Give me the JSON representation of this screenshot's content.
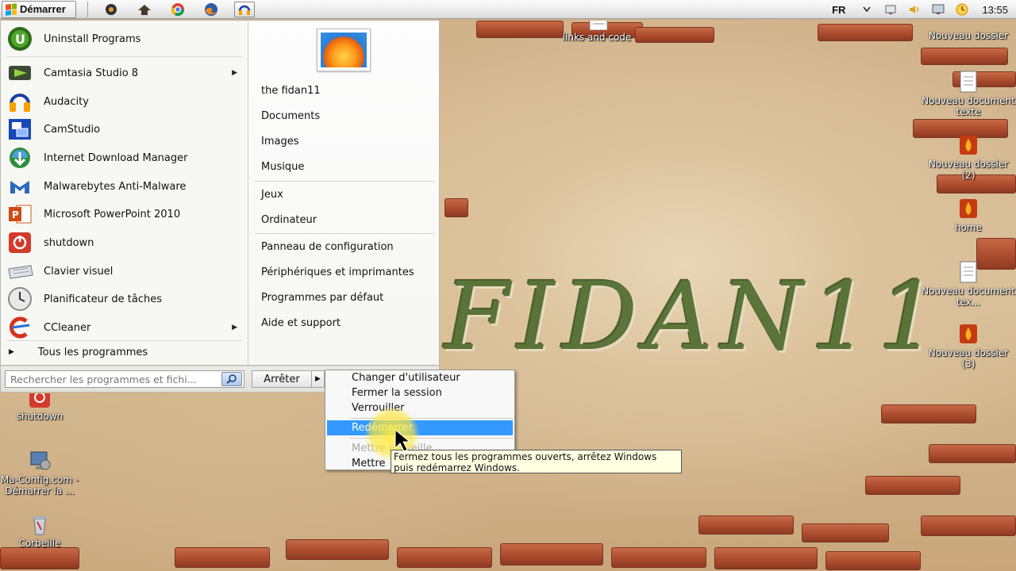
{
  "taskbar": {
    "start_label": "Démarrer",
    "language": "FR",
    "clock": "13:55",
    "quicklaunch": [
      "media-icon",
      "explorer-icon",
      "chrome-icon",
      "firefox-icon",
      "audacity-icon"
    ]
  },
  "start_menu": {
    "pinned": [
      {
        "label": "Uninstall Programs",
        "icon": "uninstall-icon"
      }
    ],
    "programs": [
      {
        "label": "Camtasia Studio 8",
        "icon": "camtasia-icon",
        "submenu": true
      },
      {
        "label": "Audacity",
        "icon": "audacity-icon",
        "submenu": false
      },
      {
        "label": "CamStudio",
        "icon": "camstudio-icon",
        "submenu": false
      },
      {
        "label": "Internet Download Manager",
        "icon": "idm-icon",
        "submenu": false
      },
      {
        "label": "Malwarebytes Anti-Malware",
        "icon": "malwarebytes-icon",
        "submenu": false
      },
      {
        "label": "Microsoft PowerPoint 2010",
        "icon": "powerpoint-icon",
        "submenu": false
      },
      {
        "label": "shutdown",
        "icon": "shutdown-icon",
        "submenu": false
      },
      {
        "label": "Clavier visuel",
        "icon": "keyboard-icon",
        "submenu": false
      },
      {
        "label": "Planificateur de tâches",
        "icon": "clock-icon",
        "submenu": false
      },
      {
        "label": "CCleaner",
        "icon": "ccleaner-icon",
        "submenu": true
      }
    ],
    "all_programs": "Tous les programmes",
    "search_placeholder": "Rechercher les programmes et fichi...",
    "shutdown_label": "Arrêter",
    "right_links": {
      "user": "the fidan11",
      "documents": "Documents",
      "images": "Images",
      "musique": "Musique",
      "jeux": "Jeux",
      "ordinateur": "Ordinateur",
      "panneau": "Panneau de configuration",
      "peripheriques": "Périphériques et imprimantes",
      "programmes_defaut": "Programmes par défaut",
      "aide": "Aide et support"
    }
  },
  "shutdown_menu": {
    "items": [
      {
        "label": "Changer d'utilisateur",
        "state": "normal"
      },
      {
        "label": "Fermer la session",
        "state": "normal"
      },
      {
        "label": "Verrouiller",
        "state": "normal"
      },
      {
        "label": "Redémarrer",
        "state": "highlighted"
      },
      {
        "label": "Mettre en veille",
        "state": "disabled"
      },
      {
        "label": "Mettre",
        "state": "normal"
      }
    ]
  },
  "tooltip": {
    "line1": "Fermez tous les programmes ouverts, arrêtez Windows",
    "line2": "puis redémarrez Windows."
  },
  "desktop": {
    "wallpaper_text": "FIDAN11",
    "icons": [
      {
        "label": "links and code"
      },
      {
        "label": "Nouveau dossier"
      },
      {
        "label": "Nouveau document texte"
      },
      {
        "label": "Nouveau dossier (2)"
      },
      {
        "label": "home"
      },
      {
        "label": "Nouveau document tex..."
      },
      {
        "label": "Nouveau dossier (3)"
      },
      {
        "label": "shutdown"
      },
      {
        "label": "Ma-Config.com - Démarrer la ..."
      },
      {
        "label": "Corbeille"
      }
    ]
  },
  "colors": {
    "highlight": "#3399ff",
    "tooltip_bg": "#ffffe1",
    "wallpaper_green": "#4c6b2e",
    "brick": "#a94a2c"
  }
}
